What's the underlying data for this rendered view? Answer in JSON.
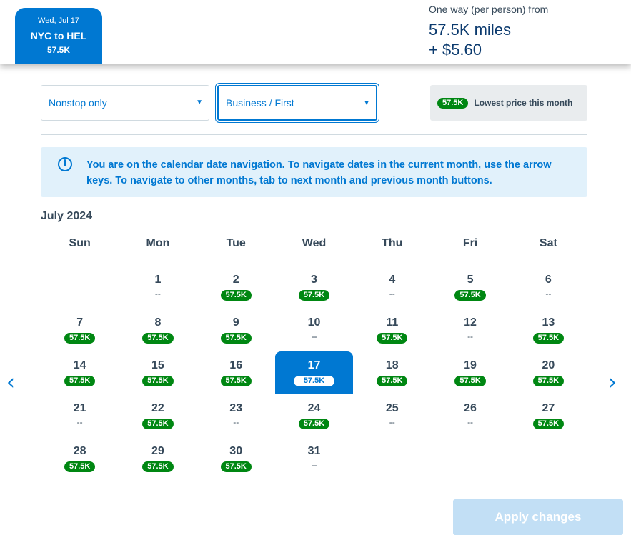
{
  "header": {
    "tab": {
      "date": "Wed, Jul 17",
      "route": "NYC to HEL",
      "price": "57.5K"
    },
    "fare": {
      "label": "One way (per person) from",
      "miles": "57.5K miles",
      "cash": "+ $5.60"
    }
  },
  "filters": {
    "stops": "Nonstop only",
    "cabin": "Business / First",
    "legend_price": "57.5K",
    "legend_label": "Lowest price this month"
  },
  "info": "You are on the calendar date navigation. To navigate dates in the current month, use the arrow keys. To navigate to other months, tab to next month and previous month buttons.",
  "calendar": {
    "month": "July 2024",
    "weekdays": [
      "Sun",
      "Mon",
      "Tue",
      "Wed",
      "Thu",
      "Fri",
      "Sat"
    ],
    "first_weekday": 1,
    "selected": 17,
    "no_price": "--",
    "days": [
      {
        "d": "1",
        "p": null
      },
      {
        "d": "2",
        "p": "57.5K"
      },
      {
        "d": "3",
        "p": "57.5K"
      },
      {
        "d": "4",
        "p": null
      },
      {
        "d": "5",
        "p": "57.5K"
      },
      {
        "d": "6",
        "p": null
      },
      {
        "d": "7",
        "p": "57.5K"
      },
      {
        "d": "8",
        "p": "57.5K"
      },
      {
        "d": "9",
        "p": "57.5K"
      },
      {
        "d": "10",
        "p": null
      },
      {
        "d": "11",
        "p": "57.5K"
      },
      {
        "d": "12",
        "p": null
      },
      {
        "d": "13",
        "p": "57.5K"
      },
      {
        "d": "14",
        "p": "57.5K"
      },
      {
        "d": "15",
        "p": "57.5K"
      },
      {
        "d": "16",
        "p": "57.5K"
      },
      {
        "d": "17",
        "p": "57.5K"
      },
      {
        "d": "18",
        "p": "57.5K"
      },
      {
        "d": "19",
        "p": "57.5K"
      },
      {
        "d": "20",
        "p": "57.5K"
      },
      {
        "d": "21",
        "p": null
      },
      {
        "d": "22",
        "p": "57.5K"
      },
      {
        "d": "23",
        "p": null
      },
      {
        "d": "24",
        "p": "57.5K"
      },
      {
        "d": "25",
        "p": null
      },
      {
        "d": "26",
        "p": null
      },
      {
        "d": "27",
        "p": "57.5K"
      },
      {
        "d": "28",
        "p": "57.5K"
      },
      {
        "d": "29",
        "p": "57.5K"
      },
      {
        "d": "30",
        "p": "57.5K"
      },
      {
        "d": "31",
        "p": null
      }
    ]
  },
  "nav": {
    "prev": "‹",
    "next": "›"
  },
  "apply": "Apply changes"
}
